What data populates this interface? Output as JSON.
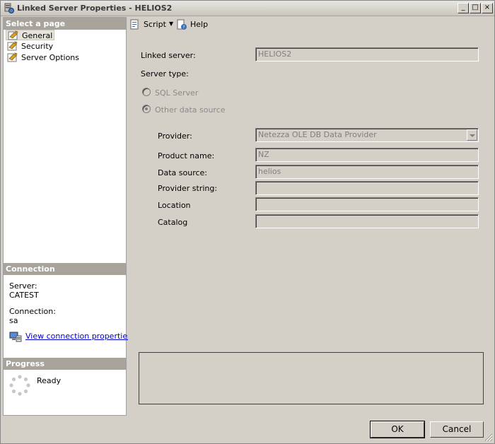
{
  "window": {
    "title": "Linked Server Properties - HELIOS2",
    "controls": {
      "minimize": "_",
      "maximize": "□",
      "close": "×"
    }
  },
  "left_pane": {
    "select_page_header": "Select a page",
    "pages": [
      {
        "label": "General",
        "icon": "wrench-page-icon",
        "selected": true
      },
      {
        "label": "Security",
        "icon": "wrench-page-icon",
        "selected": false
      },
      {
        "label": "Server Options",
        "icon": "wrench-page-icon",
        "selected": false
      }
    ],
    "connection_header": "Connection",
    "server_label": "Server:",
    "server_value": "CATEST",
    "connection_label": "Connection:",
    "connection_value": "sa",
    "view_connection_link": "View connection properties",
    "progress_header": "Progress",
    "progress_status": "Ready"
  },
  "toolbar": {
    "script_label": "Script",
    "help_label": "Help"
  },
  "form": {
    "linked_server_label": "Linked server:",
    "linked_server_value": "HELIOS2",
    "server_type_label": "Server type:",
    "sql_server_label": "SQL Server",
    "other_source_label": "Other data source",
    "provider_label": "Provider:",
    "provider_value": "Netezza OLE DB Data Provider",
    "product_name_label": "Product name:",
    "product_name_value": "NZ",
    "data_source_label": "Data source:",
    "data_source_value": "helios",
    "provider_string_label": "Provider string:",
    "provider_string_value": "",
    "location_label": "Location",
    "location_value": "",
    "catalog_label": "Catalog",
    "catalog_value": ""
  },
  "buttons": {
    "ok_label": "OK",
    "cancel_label": "Cancel"
  },
  "colors": {
    "link": "#0000cc",
    "pane_header": "#a8a49c",
    "window_bg": "#d4d0c8"
  }
}
